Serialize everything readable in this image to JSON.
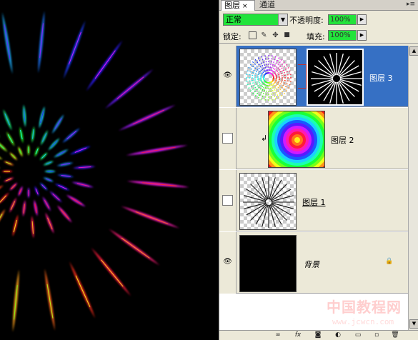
{
  "tabs": [
    {
      "label": "图层",
      "active": true
    },
    {
      "label": "通道",
      "active": false
    }
  ],
  "close_glyph": "×",
  "panel_menu_glyph": "▸≡",
  "blend_mode": "正常",
  "opacity_label": "不透明度:",
  "opacity_value": "100%",
  "lock_label": "锁定:",
  "fill_label": "填充:",
  "fill_value": "100%",
  "layers": [
    {
      "name": "图层 3",
      "visible": true,
      "selected": true,
      "thumbnail": "starburst-color",
      "mask": "starburst-mask"
    },
    {
      "name": "图层 2",
      "visible": false,
      "selected": false,
      "thumbnail": "rainbow-rings",
      "clipped": true
    },
    {
      "name": "图层 1",
      "visible": false,
      "selected": false,
      "thumbnail": "starburst-lines"
    },
    {
      "name": "背景",
      "visible": true,
      "selected": false,
      "thumbnail": "black",
      "locked": true
    }
  ],
  "eye_glyph": "👁",
  "clip_glyph": "↲",
  "lock_glyph": "🔒",
  "watermark": {
    "title": "中国教程网",
    "url": "www.jcwcn.com"
  },
  "colors": {
    "accent_green": "#22e33b",
    "selected_row": "#3670c4",
    "panel_bg": "#ece9d8"
  }
}
